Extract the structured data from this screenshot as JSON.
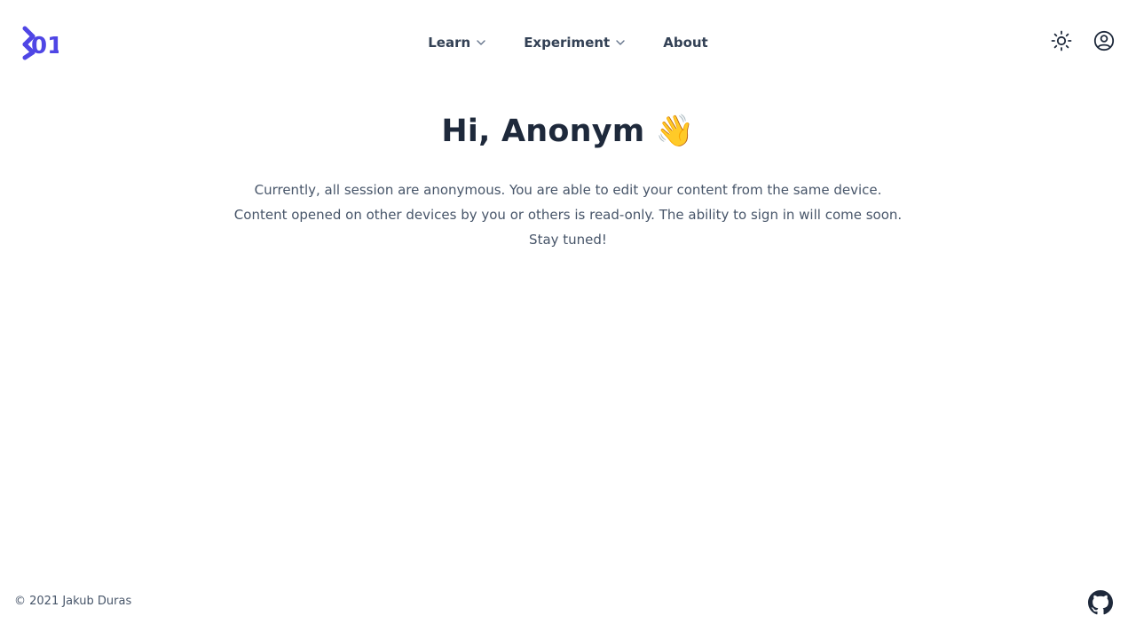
{
  "header": {
    "brand": "01",
    "nav": {
      "learn": "Learn",
      "experiment": "Experiment",
      "about": "About"
    }
  },
  "main": {
    "title": "Hi, Anonym",
    "title_emoji": "👋",
    "intro": "Currently, all session are anonymous. You are able to edit your content from the same device. Content opened on other devices by you or others is read-only. The ability to sign in will come soon. Stay tuned!"
  },
  "footer": {
    "copyright": "© 2021 Jakub Duras"
  },
  "icons": {
    "theme": "sun-icon",
    "account": "user-circle-icon",
    "repo": "github-icon",
    "dropdown": "chevron-down-icon"
  },
  "colors": {
    "brand": "#4f46e5",
    "text": "#1e293b",
    "muted": "#475569"
  }
}
